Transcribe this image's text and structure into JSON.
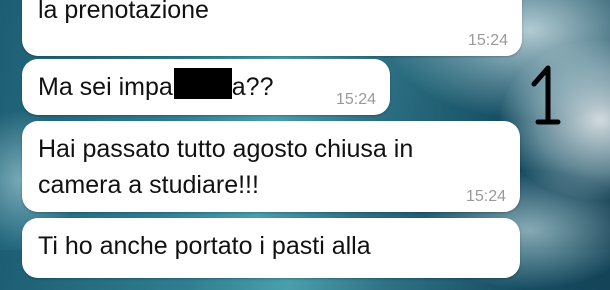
{
  "chat": {
    "messages": [
      {
        "text": "la prenotazione",
        "time": "15:24"
      },
      {
        "text_before": "Ma sei impa",
        "redacted": true,
        "text_after": "a??",
        "time": "15:24"
      },
      {
        "text": "Hai passato tutto agosto chiusa in\ncamera a studiare!!!",
        "time": "15:24"
      },
      {
        "text": "Ti ho anche portato i pasti alla"
      }
    ],
    "bubble_color": "#ffffff",
    "time_color": "#9a9a9a"
  },
  "annotation": {
    "text": "1"
  },
  "background": {
    "theme": "ocean-wave-wallpaper",
    "colors": [
      "#1d5d73",
      "#4a9fad",
      "#123f53"
    ]
  }
}
